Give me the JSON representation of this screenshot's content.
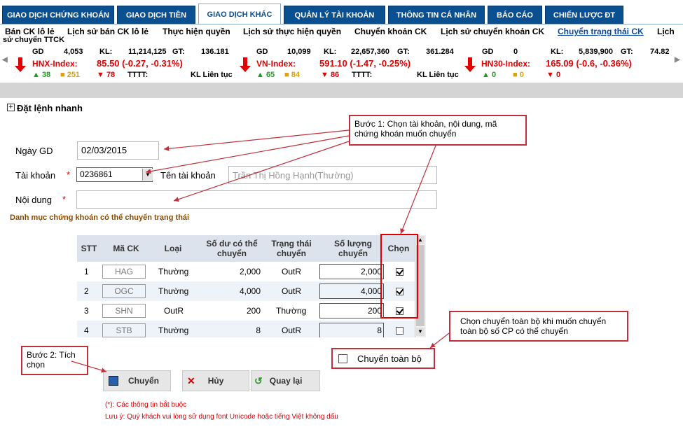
{
  "tabs": [
    {
      "label": "GIAO DỊCH CHỨNG KHOÁN"
    },
    {
      "label": "GIAO DỊCH TIỀN"
    },
    {
      "label": "GIAO DỊCH KHÁC"
    },
    {
      "label": "QUẢN LÝ TÀI KHOẢN"
    },
    {
      "label": "THÔNG TIN CÁ NHÂN"
    },
    {
      "label": "BÁO CÁO"
    },
    {
      "label": "CHIẾN LƯỢC ĐT"
    }
  ],
  "subnav": [
    {
      "label": "Bán CK lô lẻ"
    },
    {
      "label": "Lịch sử bán CK lô lẻ"
    },
    {
      "label": "Thực hiện quyền"
    },
    {
      "label": "Lịch sử thực hiện quyền"
    },
    {
      "label": "Chuyển khoản CK"
    },
    {
      "label": "Lịch sử chuyển khoản CK"
    },
    {
      "label": "Chuyển trạng thái CK"
    },
    {
      "label": "Lịch"
    },
    {
      "label": "sử chuyển TTCK"
    }
  ],
  "ticker": [
    {
      "gd_label": "GD",
      "gd": "4,053",
      "kl_label": "KL:",
      "kl": "11,214,125",
      "gt_label": "GT:",
      "gt": "136.181",
      "name": "HNX-Index:",
      "value": "85.50 (-0.27, -0.31%)",
      "up": "▲ 38",
      "ref": "■ 251",
      "down": "▼ 78",
      "tttt": "TTTT:",
      "session": "KL Liên tục"
    },
    {
      "gd_label": "GD",
      "gd": "10,099",
      "kl_label": "KL:",
      "kl": "22,657,360",
      "gt_label": "GT:",
      "gt": "361.284",
      "name": "VN-Index:",
      "value": "591.10 (-1.47, -0.25%)",
      "up": "▲ 65",
      "ref": "■ 84",
      "down": "▼ 86",
      "tttt": "TTTT:",
      "session": "KL Liên tục"
    },
    {
      "gd_label": "GD",
      "gd": "0",
      "kl_label": "KL:",
      "kl": "5,839,900",
      "gt_label": "GT:",
      "gt": "74.82",
      "name": "HN30-Index:",
      "value": "165.09 (-0.6, -0.36%)",
      "up": "▲ 0",
      "ref": "■ 0",
      "down": "▼ 0"
    }
  ],
  "quick_order": {
    "label": "Đặt lệnh nhanh",
    "toggle": "+"
  },
  "form": {
    "date_label": "Ngày GD",
    "date_value": "02/03/2015",
    "account_label": "Tài khoản",
    "account_value": "0236861",
    "account_name_label": "Tên tài khoản",
    "account_name_value": "Trần Thị Hồng Hạnh(Thường)",
    "content_label": "Nội dung",
    "content_value": "",
    "required_mark": "*",
    "section_title": "Danh mục chứng khoán có thể chuyển trạng thái"
  },
  "table": {
    "headers": [
      "STT",
      "Mã CK",
      "Loại",
      "Số dư có thể chuyển",
      "Trạng thái chuyển",
      "Số lượng chuyển",
      "Chọn"
    ],
    "rows": [
      {
        "stt": "1",
        "code": "HAG",
        "type": "Thường",
        "balance": "2,000",
        "status": "OutR",
        "qty": "2,000",
        "checked": true
      },
      {
        "stt": "2",
        "code": "OGC",
        "type": "Thường",
        "balance": "4,000",
        "status": "OutR",
        "qty": "4,000",
        "checked": true
      },
      {
        "stt": "3",
        "code": "SHN",
        "type": "OutR",
        "balance": "200",
        "status": "Thường",
        "qty": "200",
        "checked": true
      },
      {
        "stt": "4",
        "code": "STB",
        "type": "Thường",
        "balance": "8",
        "status": "OutR",
        "qty": "8",
        "checked": false
      }
    ]
  },
  "transfer_all_label": "Chuyển toàn bộ",
  "buttons": {
    "transfer": "Chuyển",
    "cancel": "Hủy",
    "back": "Quay lại"
  },
  "notes": {
    "required": "(*): Các thông tin bắt buộc",
    "font": "Lưu ý: Quý khách vui lòng sử dụng font Unicode hoặc tiếng Việt không dấu"
  },
  "callouts": {
    "step1": "Bước 1: Chọn tài khoản, nội dung, mã chứng khoán muốn chuyển",
    "step2": "Bước 2: Tích chọn",
    "all": "Chọn chuyển toàn bộ khi muốn chuyển toàn bộ số CP có thể chuyển"
  },
  "colors": {
    "tab_bg": "#0a4f8f",
    "callout_border": "#c0303a",
    "red": "#e00000",
    "green": "#1e9e1e"
  }
}
